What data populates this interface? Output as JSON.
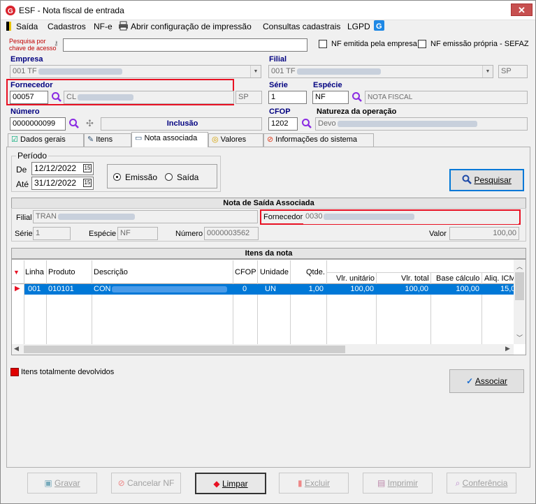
{
  "window": {
    "title": "ESF - Nota fiscal de entrada",
    "close": "✕"
  },
  "menu": [
    "Saída",
    "Cadastros",
    "NF-e",
    "Abrir configuração de impressão",
    "Consultas cadastrais",
    "LGPD"
  ],
  "search": {
    "label1": "Pesquisa por",
    "label2": "chave de acesso",
    "value": "",
    "check1": "NF emitida pela empresa",
    "check2": "NF emissão própria - SEFAZ"
  },
  "empresa": {
    "label": "Empresa",
    "value": "001 TF"
  },
  "filial": {
    "label": "Filial",
    "value": "001 TF",
    "uf": "SP"
  },
  "fornecedor": {
    "label": "Fornecedor",
    "code": "00057",
    "name": "CL",
    "uf": "SP"
  },
  "serie": {
    "label": "Série",
    "value": "1"
  },
  "especie": {
    "label": "Espécie",
    "value": "NF",
    "desc": "NOTA FISCAL"
  },
  "numero": {
    "label": "Número",
    "value": "0000000099",
    "mode": "Inclusão"
  },
  "cfop": {
    "label": "CFOP",
    "value": "1202"
  },
  "natureza": {
    "label": "Natureza da operação",
    "value": "Devo"
  },
  "tabs": [
    "Dados gerais",
    "Itens",
    "Nota associada",
    "Valores",
    "Informações do sistema"
  ],
  "periodo": {
    "label": "Período",
    "de_label": "De",
    "de": "12/12/2022",
    "ate_label": "Até",
    "ate": "31/12/2022",
    "cal": "15",
    "emissao": "Emissão",
    "saida": "Saída"
  },
  "pesquisar": "Pesquisar",
  "nota_saida": {
    "title": "Nota de Saída Associada",
    "filial_label": "Filial",
    "filial": "TRAN",
    "fornecedor_label": "Fornecedor",
    "fornecedor": "0030",
    "serie_label": "Série",
    "serie": "1",
    "especie_label": "Espécie",
    "especie": "NF",
    "numero_label": "Número",
    "numero": "0000003562",
    "valor_label": "Valor",
    "valor": "100,00"
  },
  "itens": {
    "title": "Itens da nota",
    "headers": [
      "Linha",
      "Produto",
      "Descrição",
      "CFOP",
      "Unidade",
      "Qtde.",
      "Vlr. unitário",
      "Vlr. total",
      "Base cálculo",
      "Aliq. ICM"
    ],
    "row": {
      "linha": "001",
      "produto": "010101",
      "descricao": "CON",
      "cfop": "0",
      "unidade": "UN",
      "qtde": "1,00",
      "vlr_unit": "100,00",
      "vlr_total": "100,00",
      "base": "100,00",
      "aliq": "15,0"
    }
  },
  "legend": "Itens totalmente devolvidos",
  "associar": "Associar",
  "footer": {
    "gravar": "Gravar",
    "cancelar": "Cancelar NF",
    "limpar": "Limpar",
    "excluir": "Excluir",
    "imprimir": "Imprimir",
    "conferencia": "Conferência"
  },
  "colors": {
    "accent": "#0078d7",
    "highlight": "#e81123",
    "label": "#000080"
  }
}
